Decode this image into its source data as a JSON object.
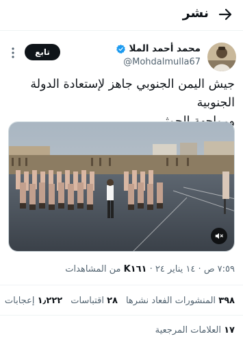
{
  "header": {
    "title": "نشر"
  },
  "author": {
    "name": "محمد أحمد الملا",
    "handle": "@Mohdalmulla67",
    "verified": true
  },
  "follow_label": "تابع",
  "tweet": {
    "text_line_1": "جيش اليمن الجنوبي جاهز لإستعادة الدولة الجنوبية",
    "text_line_2": "ومواجهة الحوثي ."
  },
  "meta": {
    "time": "٧:٥٩ ص",
    "date": "١٤ يناير ٢٤",
    "views_count": "K١٦١",
    "views_label": "من المشاهدات"
  },
  "stats": {
    "quotes_count": "٣٩٨",
    "quotes_label": "المنشورات الفعاد نشرها",
    "retweets_count": "٢٨",
    "retweets_label": "اقتباسات",
    "likes_count": "١٫٢٢٢",
    "likes_label": "إعجابات"
  },
  "bookmarks": {
    "count": "١٧",
    "label": "العلامات المرجعية"
  },
  "colors": {
    "accent": "#1d9bf0",
    "text": "#0f1419",
    "muted": "#536471",
    "border": "#eff3f4"
  },
  "icons": {
    "back": "arrow-right-icon",
    "verified": "verified-badge-icon",
    "more": "more-dots-icon",
    "mute": "speaker-muted-icon"
  }
}
